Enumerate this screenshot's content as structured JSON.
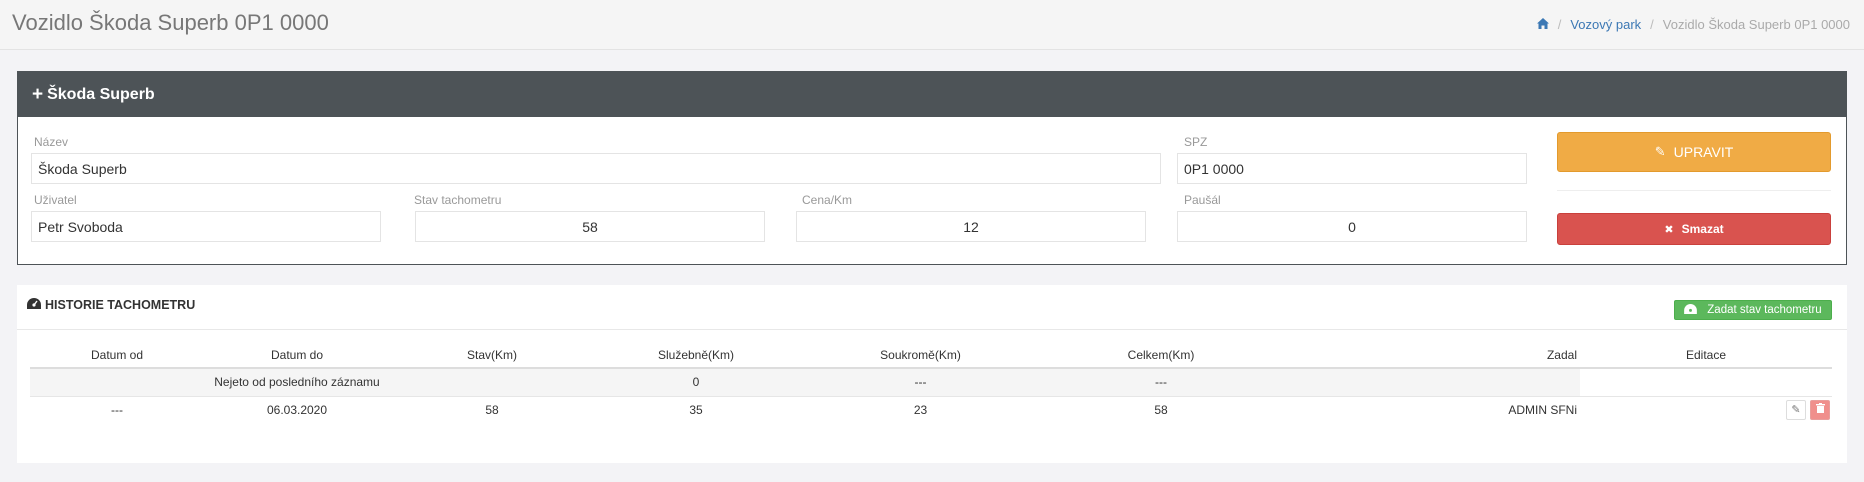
{
  "page": {
    "title": "Vozidlo Škoda Superb 0P1 0000",
    "breadcrumb": {
      "home_icon": "home-icon",
      "link": "Vozový park",
      "current": "Vozidlo Škoda Superb 0P1 0000"
    }
  },
  "vehicle": {
    "heading": "Škoda Superb",
    "fields": {
      "nazev": {
        "label": "Název",
        "value": "Škoda Superb"
      },
      "spz": {
        "label": "SPZ",
        "value": "0P1 0000"
      },
      "uzivatel": {
        "label": "Uživatel",
        "value": "Petr Svoboda"
      },
      "stav": {
        "label": "Stav tachometru",
        "value": "58"
      },
      "cena": {
        "label": "Cena/Km",
        "value": "12"
      },
      "pausal": {
        "label": "Paušál",
        "value": "0"
      }
    },
    "buttons": {
      "upravit": "UPRAVIT",
      "smazat": "Smazat"
    },
    "colors": {
      "header_bg": "#4d5357",
      "upravit": "#f0ab45",
      "smazat": "#d9534f"
    }
  },
  "history": {
    "title": "HISTORIE TACHOMETRU",
    "add_button": "Zadat stav tachometru",
    "columns": [
      "Datum od",
      "Datum do",
      "Stav(Km)",
      "Služebně(Km)",
      "Soukromě(Km)",
      "Celkem(Km)",
      "Zadal",
      "Editace"
    ],
    "summary_row": {
      "datum_do": "Nejeto od posledního záznamu",
      "sluzebne": "0",
      "soukrome": "---",
      "celkem": "---"
    },
    "rows": [
      {
        "datum_od": "---",
        "datum_do": "06.03.2020",
        "stav": "58",
        "sluzebne": "35",
        "soukrome": "23",
        "celkem": "58",
        "zadal": "ADMIN SFNi"
      }
    ]
  }
}
